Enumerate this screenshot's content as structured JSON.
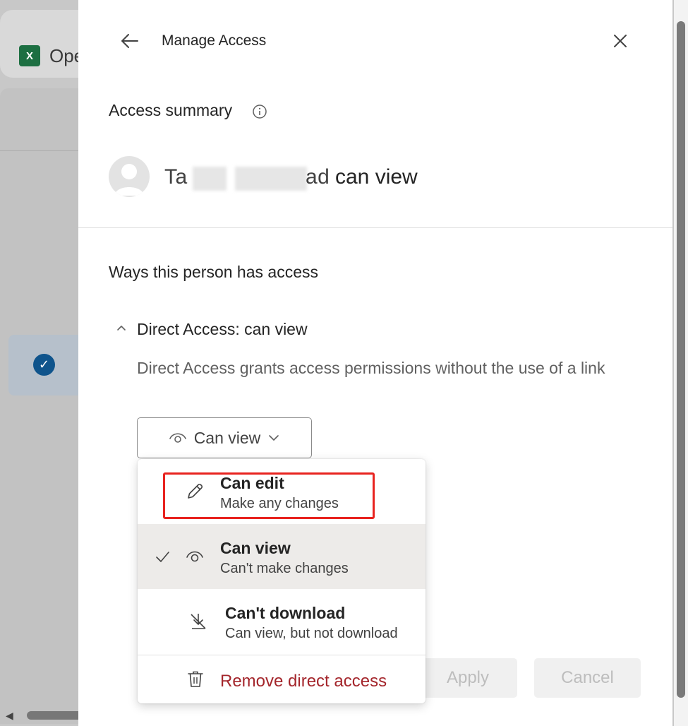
{
  "background": {
    "app_tab_label": "Ope"
  },
  "dialog": {
    "title": "Manage Access",
    "access_summary_title": "Access summary",
    "person_name_visible_start": "Ta",
    "person_name_visible_end": "ad",
    "person_permission": "can view",
    "ways_title": "Ways this person has access",
    "direct_access_title": "Direct Access: can view",
    "direct_access_description": "Direct Access grants access permissions without the use of a link",
    "permission_dropdown_label": "Can view",
    "apply_label": "Apply",
    "cancel_label": "Cancel"
  },
  "menu": {
    "items": [
      {
        "title": "Can edit",
        "subtitle": "Make any changes",
        "icon": "pencil-icon",
        "selected": false
      },
      {
        "title": "Can view",
        "subtitle": "Can't make changes",
        "icon": "eye-icon",
        "selected": true
      },
      {
        "title": "Can't download",
        "subtitle": "Can view, but not download",
        "icon": "no-download-icon",
        "selected": false
      }
    ],
    "remove_label": "Remove direct access"
  },
  "colors": {
    "accent_red": "#a4262c",
    "highlight_red": "#e8231f",
    "selected_bg": "#edebe9"
  }
}
